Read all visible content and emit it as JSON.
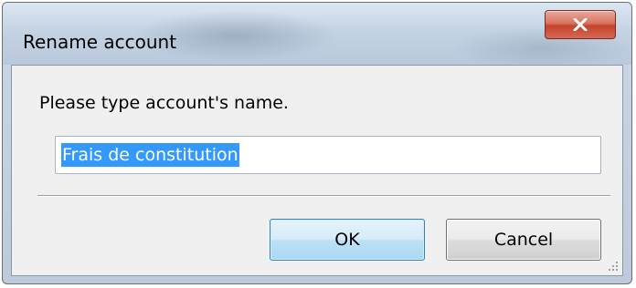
{
  "window": {
    "title": "Rename account"
  },
  "titlebar": {
    "close_icon": "close-x-icon"
  },
  "dialog": {
    "prompt": "Please type account's name.",
    "name_field_value": "Frais de constitution",
    "ok_label": "OK",
    "cancel_label": "Cancel"
  },
  "colors": {
    "selection": "#3399ff",
    "close_button": "#c7422c",
    "default_button_border": "#3c7fb1"
  }
}
